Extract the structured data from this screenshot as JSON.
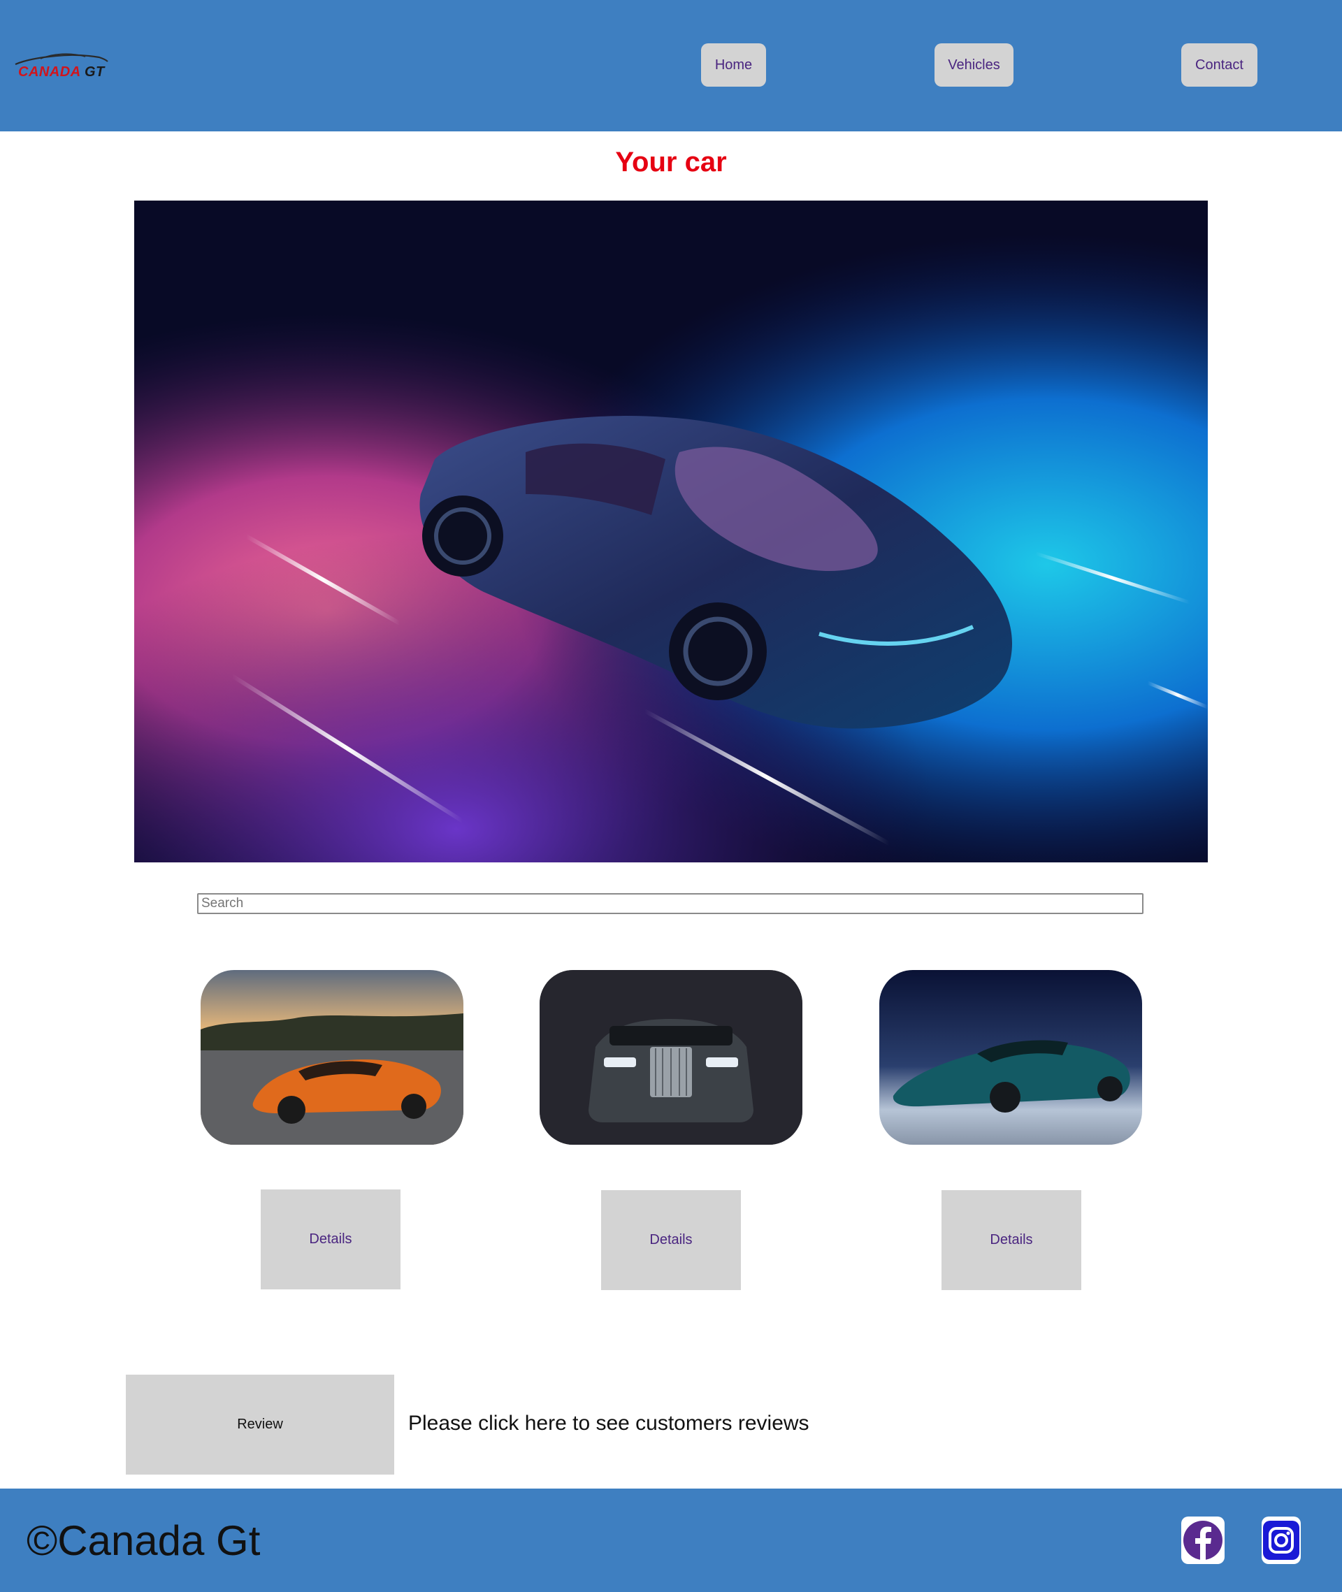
{
  "header": {
    "logo": {
      "text_main": "CANADA",
      "text_sub": "GT"
    },
    "nav": [
      {
        "label": "Home"
      },
      {
        "label": "Vehicles"
      },
      {
        "label": "Contact"
      }
    ]
  },
  "main": {
    "title": "Your car",
    "search": {
      "placeholder": "Search",
      "value": ""
    },
    "cards": [
      {
        "image": "orange-sports-car",
        "button_label": "Details"
      },
      {
        "image": "black-luxury-sedan",
        "button_label": "Details"
      },
      {
        "image": "teal-hypercar",
        "button_label": "Details"
      }
    ],
    "review": {
      "button_label": "Review",
      "text": "Please click here to see customers reviews"
    }
  },
  "footer": {
    "copyright": "©Canada Gt",
    "social": [
      {
        "icon": "facebook-icon"
      },
      {
        "icon": "instagram-icon"
      }
    ]
  },
  "colors": {
    "header_bg": "#3e7fc1",
    "title": "#e60012",
    "button_bg": "#d3d3d3",
    "button_text": "#4a2580"
  }
}
